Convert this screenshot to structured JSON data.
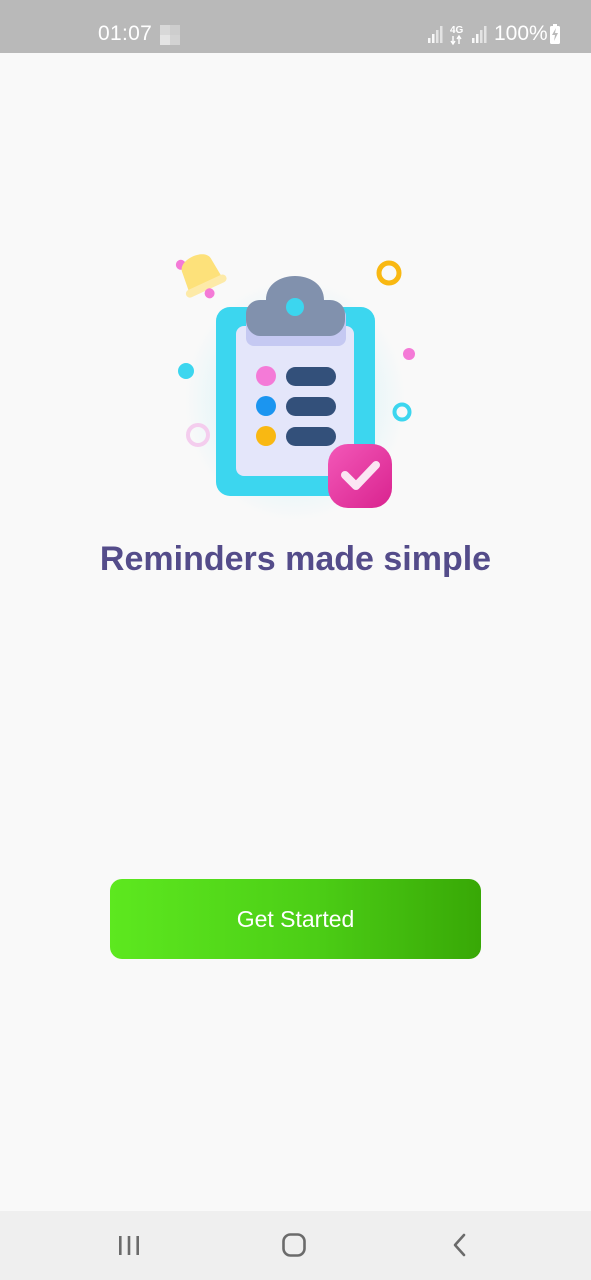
{
  "status_bar": {
    "time": "01:07",
    "network": "4G",
    "battery": "100%",
    "icons": [
      "image-thumbnail-icon",
      "signal-icon",
      "4g-data-icon",
      "signal-icon",
      "battery-charging-icon"
    ]
  },
  "illustration": {
    "icons": [
      "clipboard-checklist-icon",
      "bell-icon",
      "check-badge-icon"
    ],
    "colors": {
      "clipboard_frame": "#3cd6ef",
      "paper": "#e4e6fa",
      "clip": "#8191ad",
      "list_bar": "#33507a",
      "dot_pink": "#f47ad7",
      "dot_blue": "#1b95f0",
      "dot_yellow": "#f9b812",
      "badge": "#e83aa2",
      "bell": "#fde17a"
    }
  },
  "main": {
    "headline": "Reminders made simple",
    "button_label": "Get Started",
    "colors": {
      "headline": "#544c8a",
      "button_start": "#5de81f",
      "button_end": "#38a806"
    }
  },
  "nav_bar": {
    "icons": [
      "recent-apps-icon",
      "home-icon",
      "back-icon"
    ]
  }
}
